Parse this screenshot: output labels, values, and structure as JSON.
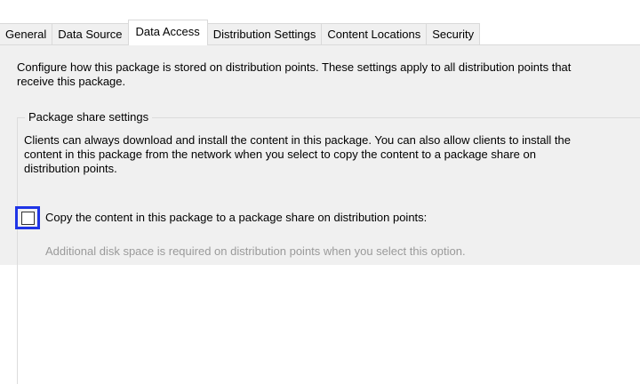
{
  "tabs": [
    {
      "label": "General",
      "active": false
    },
    {
      "label": "Data Source",
      "active": false
    },
    {
      "label": "Data Access",
      "active": true
    },
    {
      "label": "Distribution Settings",
      "active": false
    },
    {
      "label": "Content Locations",
      "active": false
    },
    {
      "label": "Security",
      "active": false
    }
  ],
  "content": {
    "intro_line1": "Configure how this package is stored on distribution points. These settings apply to all distribution points that",
    "intro_line2": "receive this package.",
    "group": {
      "title": "Package share settings",
      "desc_line1": "Clients can always download and install the content in this package. You can also allow clients to install the",
      "desc_line2": "content in this package from the network when you select to copy the content to a package share on",
      "desc_line3": "distribution points."
    },
    "checkbox": {
      "label": "Copy the content in this package to a package share on distribution points:",
      "checked": false
    },
    "hint": "Additional disk space is required on distribution points when you select this option."
  },
  "colors": {
    "highlight": "#1f35e6",
    "panel_background": "#f0f0f0",
    "disabled_text": "#9a9a9a"
  }
}
